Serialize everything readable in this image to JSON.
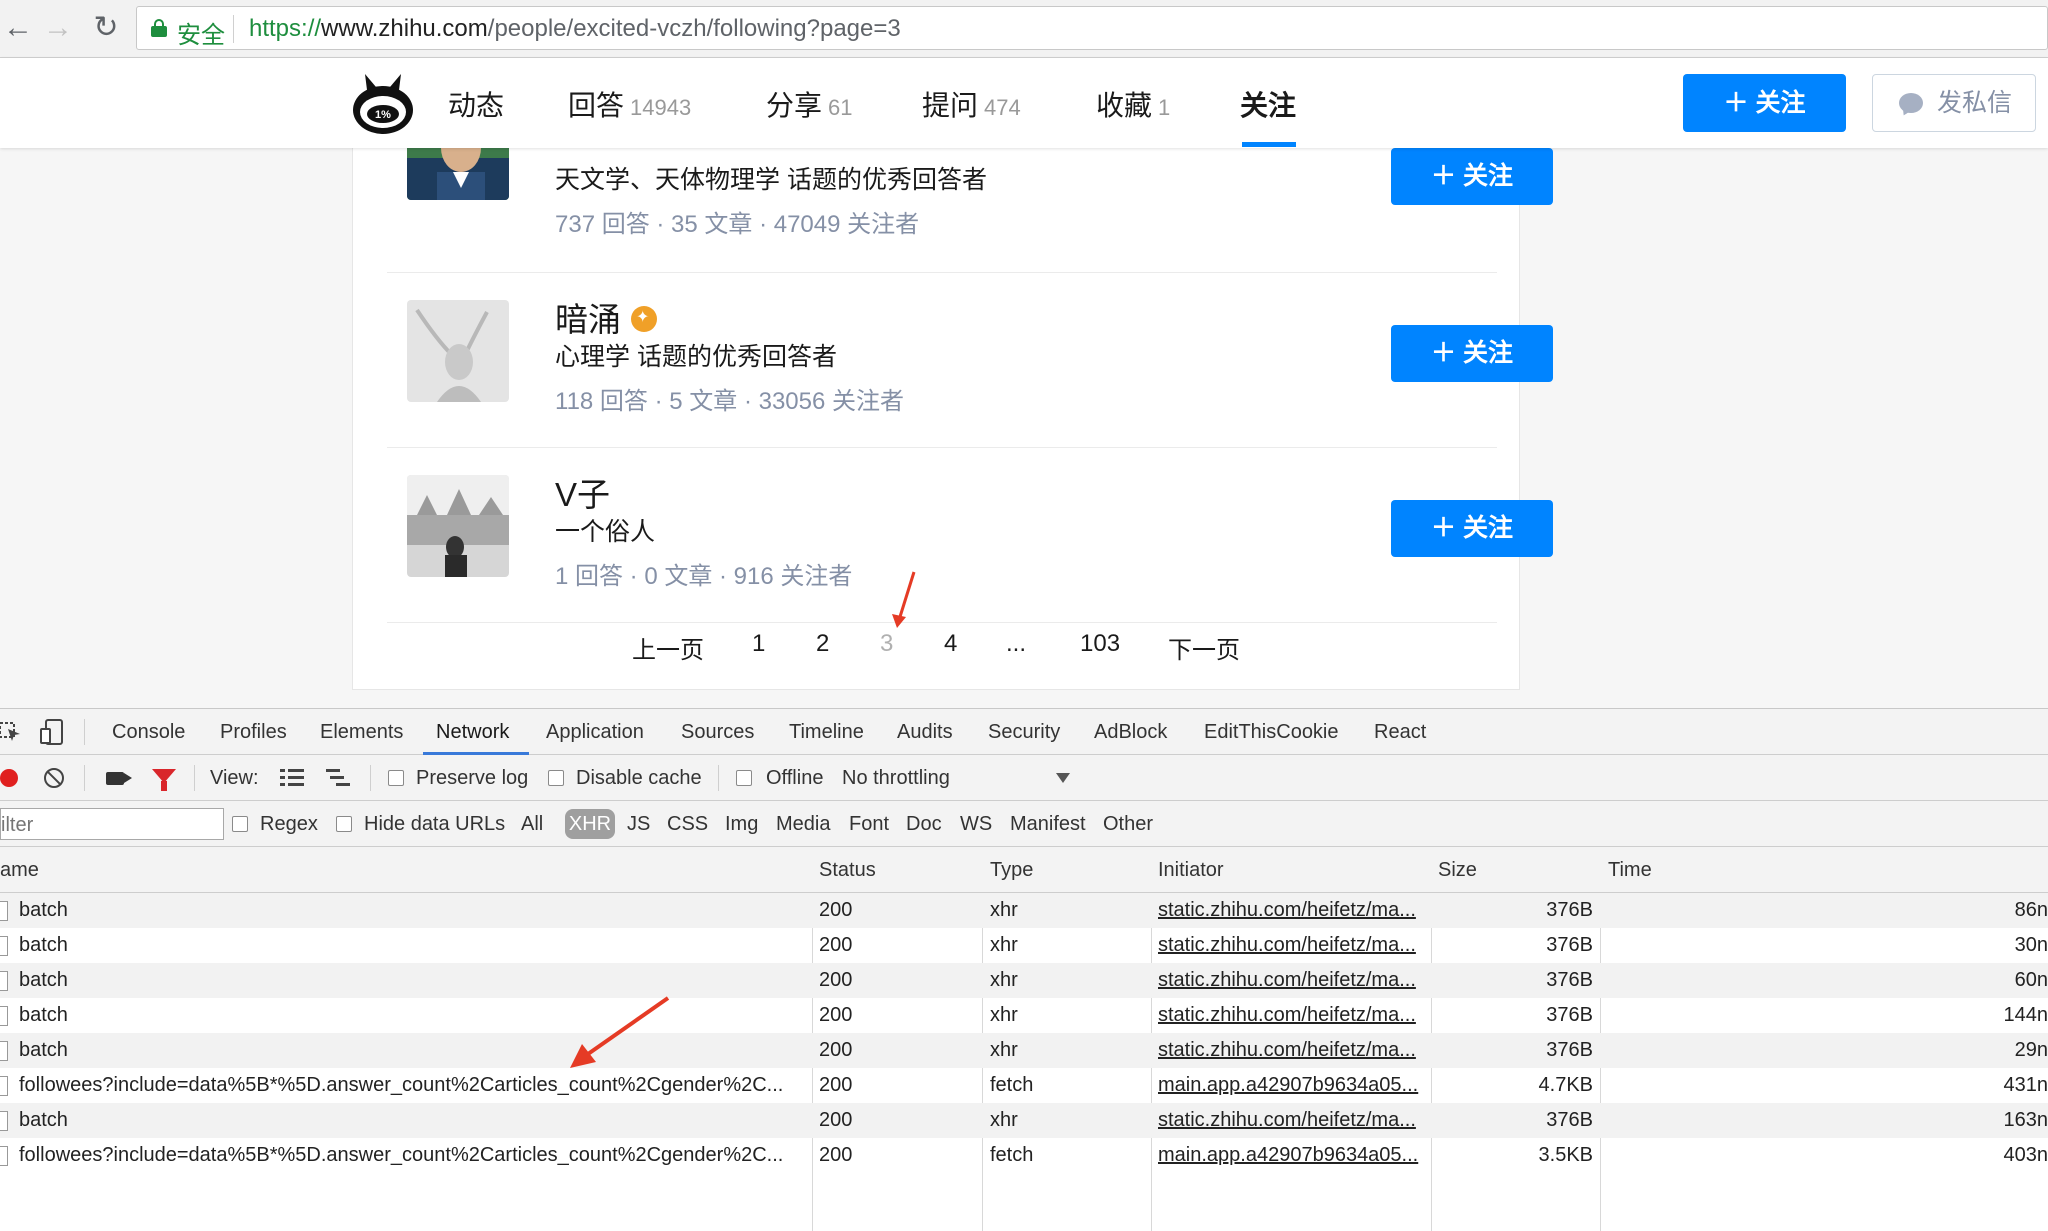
{
  "browser": {
    "secure_label": "安全",
    "url_scheme": "https://",
    "url_host": "www.zhihu.com",
    "url_path": "/people/excited-vczh/following?page=3",
    "back_icon": "←",
    "forward_icon": "→",
    "reload_icon": "↻"
  },
  "header": {
    "tabs": [
      {
        "label": "动态",
        "count": ""
      },
      {
        "label": "回答",
        "count": "14943"
      },
      {
        "label": "分享",
        "count": "61"
      },
      {
        "label": "提问",
        "count": "474"
      },
      {
        "label": "收藏",
        "count": "1"
      },
      {
        "label": "关注",
        "count": ""
      }
    ],
    "follow_button": "＋ 关注",
    "message_button": "发私信",
    "logo_text": "1%"
  },
  "users": [
    {
      "name": "",
      "desc": "天文学、天体物理学 话题的优秀回答者",
      "stats": "737 回答 · 35 文章 · 47049 关注者",
      "follow": "＋ 关注",
      "badge": false
    },
    {
      "name": "暗涌",
      "desc": "心理学 话题的优秀回答者",
      "stats": "118 回答 · 5 文章 · 33056 关注者",
      "follow": "＋ 关注",
      "badge": true
    },
    {
      "name": "V子",
      "desc": "一个俗人",
      "stats": "1 回答 · 0 文章 · 916 关注者",
      "follow": "＋ 关注",
      "badge": false
    }
  ],
  "pagination": {
    "prev": "上一页",
    "pages": [
      "1",
      "2",
      "3",
      "4",
      "...",
      "103"
    ],
    "next": "下一页",
    "current": "3"
  },
  "devtools": {
    "tabs": [
      "Console",
      "Profiles",
      "Elements",
      "Network",
      "Application",
      "Sources",
      "Timeline",
      "Audits",
      "Security",
      "AdBlock",
      "EditThisCookie",
      "React"
    ],
    "active_tab": "Network",
    "toolbar": {
      "view_label": "View:",
      "preserve_log": "Preserve log",
      "disable_cache": "Disable cache",
      "offline": "Offline",
      "throttling": "No throttling"
    },
    "filter": {
      "placeholder": "ilter",
      "regex": "Regex",
      "hide_data_urls": "Hide data URLs",
      "types": [
        "All",
        "XHR",
        "JS",
        "CSS",
        "Img",
        "Media",
        "Font",
        "Doc",
        "WS",
        "Manifest",
        "Other"
      ],
      "active_type": "XHR"
    },
    "columns": [
      "ame",
      "Status",
      "Type",
      "Initiator",
      "Size",
      "Time"
    ],
    "rows": [
      {
        "name": "batch",
        "status": "200",
        "type": "xhr",
        "initiator": "static.zhihu.com/heifetz/ma...",
        "size": "376B",
        "time": "86n"
      },
      {
        "name": "batch",
        "status": "200",
        "type": "xhr",
        "initiator": "static.zhihu.com/heifetz/ma...",
        "size": "376B",
        "time": "30n"
      },
      {
        "name": "batch",
        "status": "200",
        "type": "xhr",
        "initiator": "static.zhihu.com/heifetz/ma...",
        "size": "376B",
        "time": "60n"
      },
      {
        "name": "batch",
        "status": "200",
        "type": "xhr",
        "initiator": "static.zhihu.com/heifetz/ma...",
        "size": "376B",
        "time": "144n"
      },
      {
        "name": "batch",
        "status": "200",
        "type": "xhr",
        "initiator": "static.zhihu.com/heifetz/ma...",
        "size": "376B",
        "time": "29n"
      },
      {
        "name": "followees?include=data%5B*%5D.answer_count%2Carticles_count%2Cgender%2C...",
        "status": "200",
        "type": "fetch",
        "initiator": "main.app.a42907b9634a05...",
        "size": "4.7KB",
        "time": "431n"
      },
      {
        "name": "batch",
        "status": "200",
        "type": "xhr",
        "initiator": "static.zhihu.com/heifetz/ma...",
        "size": "376B",
        "time": "163n"
      },
      {
        "name": "followees?include=data%5B*%5D.answer_count%2Carticles_count%2Cgender%2C...",
        "status": "200",
        "type": "fetch",
        "initiator": "main.app.a42907b9634a05...",
        "size": "3.5KB",
        "time": "403n"
      }
    ]
  },
  "colors": {
    "zhihu_blue": "#0084ff",
    "annotation_red": "#e53b25",
    "devtools_accent": "#3879d9"
  }
}
